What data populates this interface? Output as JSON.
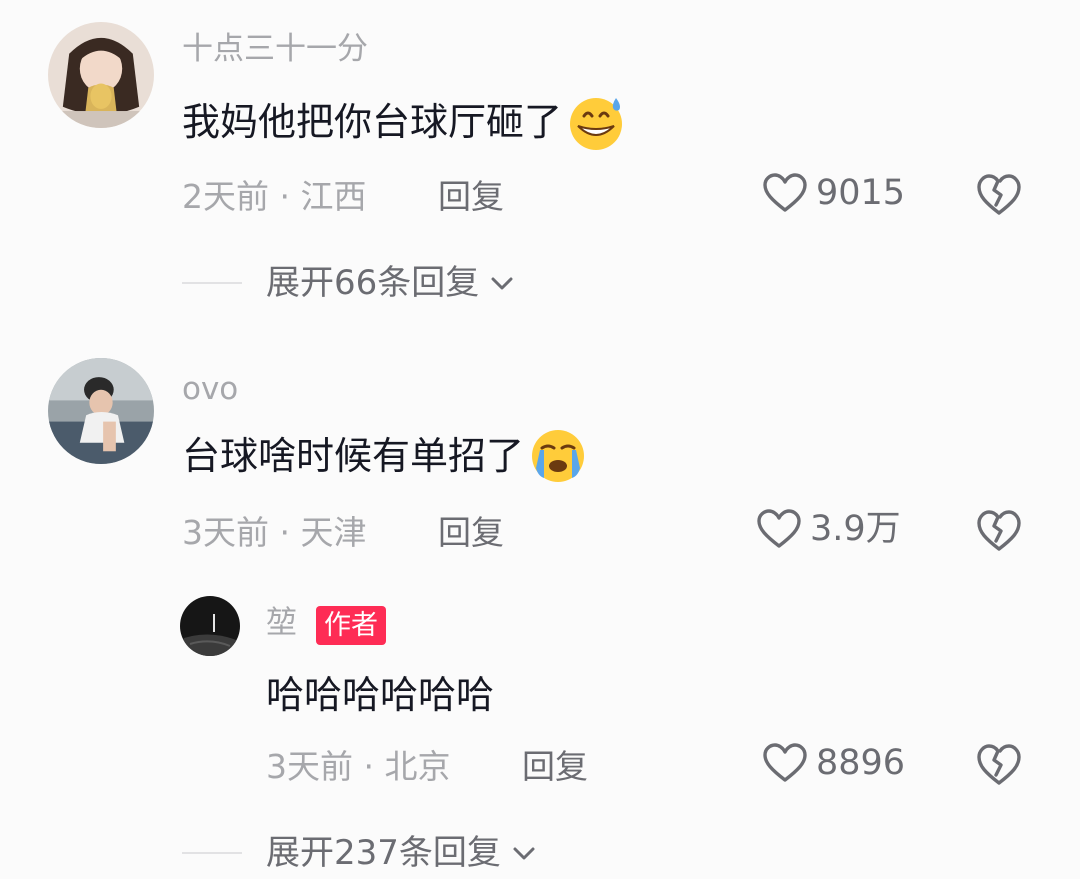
{
  "comments": [
    {
      "username": "十点三十一分",
      "text": "我妈他把你台球厅砸了",
      "emoji": "grinning-sweat-emoji",
      "time": "2天前",
      "location": "江西",
      "meta": "2天前 · 江西",
      "reply_label": "回复",
      "likes": "9015",
      "expand_label": "展开66条回复"
    },
    {
      "username": "ovo",
      "text": "台球啥时候有单招了",
      "emoji": "loudly-crying-emoji",
      "time": "3天前",
      "location": "天津",
      "meta": "3天前 · 天津",
      "reply_label": "回复",
      "likes": "3.9万",
      "replies": [
        {
          "username": "堃",
          "badge": "作者",
          "text": "哈哈哈哈哈哈",
          "time": "3天前",
          "location": "北京",
          "meta": "3天前 · 北京",
          "reply_label": "回复",
          "likes": "8896"
        }
      ],
      "expand_label": "展开237条回复"
    }
  ],
  "colors": {
    "text_primary": "#161823",
    "text_secondary": "#a6a7ab",
    "action_gray": "#6b6c72",
    "author_badge": "#fe2c55",
    "background": "#fbfbfb"
  },
  "icons": {
    "like": "heart-outline-icon",
    "dislike": "broken-heart-icon",
    "expand": "chevron-down-icon"
  }
}
